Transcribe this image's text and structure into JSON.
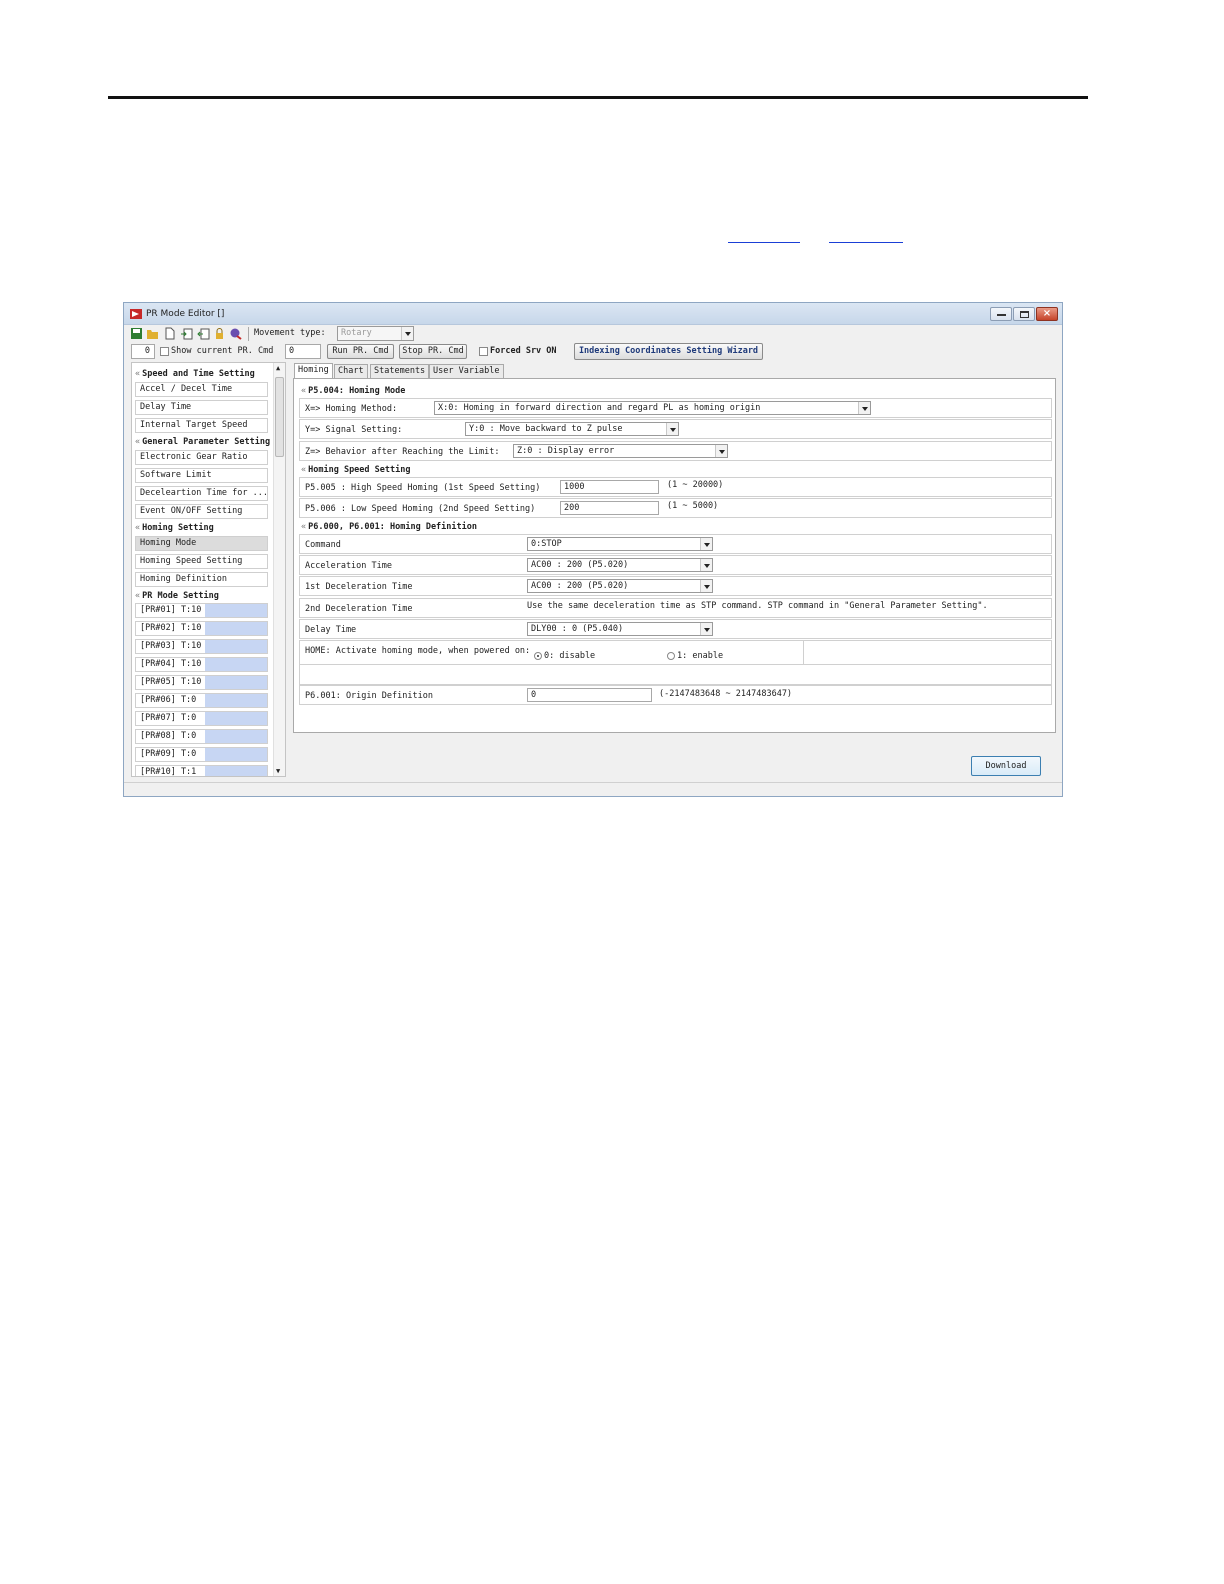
{
  "window": {
    "title": "PR Mode Editor []"
  },
  "toolbar": {
    "movement_type_label": "Movement type:",
    "movement_type_value": "Rotary",
    "pr_number_value": "0",
    "show_current_label": "Show current PR. Cmd",
    "pr_cmd_value": "0",
    "run_label": "Run PR. Cmd",
    "stop_label": "Stop PR. Cmd",
    "forced_srv_label": "Forced Srv ON",
    "wizard_label": "Indexing Coordinates Setting Wizard"
  },
  "sidebar": {
    "sections": [
      {
        "title": "Speed and Time Setting",
        "items": [
          "Accel / Decel Time",
          "Delay Time",
          "Internal Target Speed"
        ]
      },
      {
        "title": "General Parameter Setting",
        "items": [
          "Electronic Gear Ratio",
          "Software Limit",
          "Deceleartion Time for ...",
          "Event ON/OFF Setting"
        ]
      },
      {
        "title": "Homing Setting",
        "items": [
          "Homing Mode",
          "Homing Speed Setting",
          "Homing Definition"
        ]
      },
      {
        "title": "PR Mode Setting",
        "items": []
      }
    ],
    "pr_items": [
      "[PR#01] T:10",
      "[PR#02] T:10",
      "[PR#03] T:10",
      "[PR#04] T:10",
      "[PR#05] T:10",
      "[PR#06] T:0",
      "[PR#07] T:0",
      "[PR#08] T:0",
      "[PR#09] T:0",
      "[PR#10] T:1"
    ]
  },
  "tabs": [
    "Homing",
    "Chart",
    "Statements",
    "User Variable"
  ],
  "homing_mode": {
    "header": "P5.004: Homing Mode",
    "method_label": "X=> Homing Method:",
    "method_value": "X:0: Homing in forward direction and regard PL as homing origin",
    "signal_label": "Y=> Signal Setting:",
    "signal_value": "Y:0 : Move backward to Z pulse",
    "limit_label": "Z=> Behavior after Reaching the Limit:",
    "limit_value": "Z:0 : Display error"
  },
  "homing_speed": {
    "header": "Homing Speed Setting",
    "high_label": "P5.005 : High Speed Homing (1st Speed Setting)",
    "high_value": "1000",
    "high_range": "(1 ~ 20000)",
    "low_label": "P5.006 : Low Speed Homing (2nd Speed Setting)",
    "low_value": "200",
    "low_range": "(1 ~ 5000)"
  },
  "homing_definition": {
    "header": "P6.000, P6.001: Homing Definition",
    "command_label": "Command",
    "command_value": "0:STOP",
    "accel_label": "Acceleration Time",
    "accel_value": "AC00 : 200 (P5.020)",
    "decel1_label": "1st Deceleration Time",
    "decel1_value": "AC00 : 200 (P5.020)",
    "decel2_label": "2nd Deceleration Time",
    "decel2_note": "Use the same deceleration time as STP command. STP command in \"General Parameter Setting\".",
    "delay_label": "Delay Time",
    "delay_value": "DLY00 : 0 (P5.040)",
    "home_label": "HOME: Activate homing mode, when powered on:",
    "opt_disable": "0: disable",
    "opt_enable": "1: enable",
    "origin_label": "P6.001: Origin Definition",
    "origin_value": "0",
    "origin_range": "(-2147483648 ~ 2147483647)"
  },
  "download_label": "Download"
}
